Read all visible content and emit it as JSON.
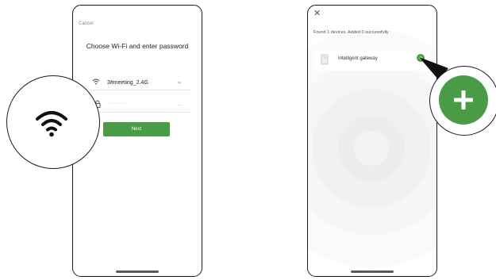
{
  "wifi_screen": {
    "cancel_label": "Cancel",
    "title": "Choose Wi-Fi and enter password",
    "ssid_value": "3#meeting_2.4G",
    "ssid_hint": "⇆",
    "password_value": "·········",
    "password_hint": "—",
    "next_label": "Next"
  },
  "found_screen": {
    "close_label": "✕",
    "found_text": "Found 1 devices. Added 0 successfully",
    "device_name": "Intelligent gateway",
    "add_label": "+"
  },
  "colors": {
    "accent_green": "#4a9b46",
    "phone_frame": "#1c1c1c",
    "background_glow": "#f2f2f2"
  },
  "icons": [
    "wifi-icon",
    "lock-icon",
    "device-icon",
    "add-icon",
    "close-icon"
  ]
}
